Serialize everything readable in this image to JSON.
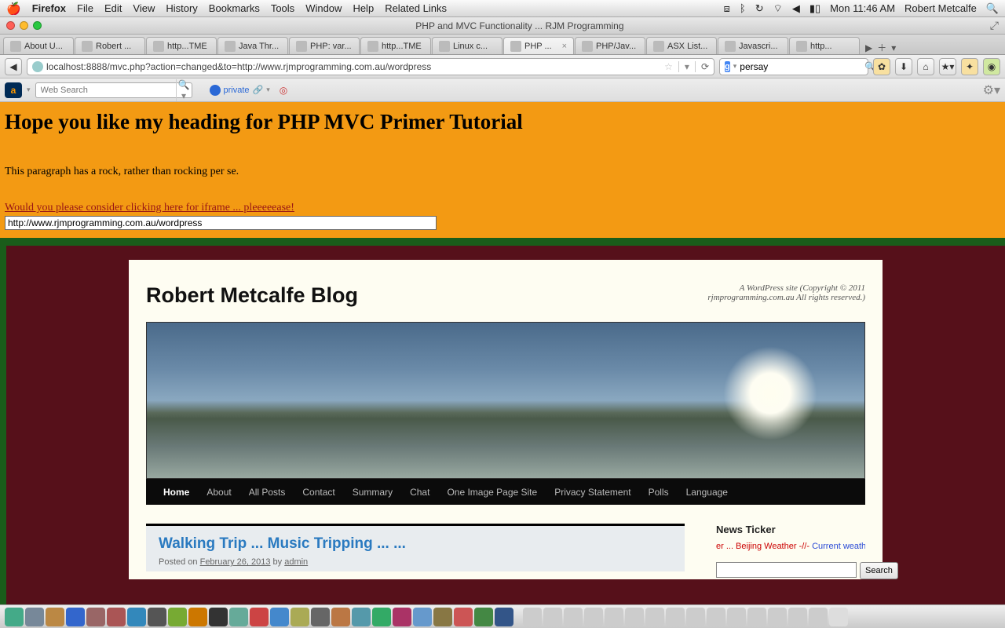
{
  "menubar": {
    "app": "Firefox",
    "items": [
      "File",
      "Edit",
      "View",
      "History",
      "Bookmarks",
      "Tools",
      "Window",
      "Help",
      "Related Links"
    ],
    "clock": "Mon 11:46 AM",
    "user": "Robert Metcalfe"
  },
  "window": {
    "title": "PHP and MVC Functionality ... RJM Programming"
  },
  "tabs": [
    {
      "label": "About U..."
    },
    {
      "label": "Robert ..."
    },
    {
      "label": "http...TME"
    },
    {
      "label": "Java Thr..."
    },
    {
      "label": "PHP: var..."
    },
    {
      "label": "http...TME"
    },
    {
      "label": "Linux c..."
    },
    {
      "label": "PHP ...",
      "active": true,
      "closeable": true
    },
    {
      "label": "PHP/Jav..."
    },
    {
      "label": "ASX List..."
    },
    {
      "label": "Javascri..."
    },
    {
      "label": "http..."
    }
  ],
  "url": {
    "value": "localhost:8888/mvc.php?action=changed&to=http://www.rjmprogramming.com.au/wordpress"
  },
  "search": {
    "value": "persay"
  },
  "toolbar2": {
    "websearch_placeholder": "Web Search",
    "private": "private"
  },
  "page": {
    "heading": "Hope you like my heading for PHP MVC Primer Tutorial",
    "paragraph": "This paragraph has a rock, rather than rocking per se.",
    "link": "Would you please consider clicking here for iframe ... pleeeeease!",
    "textbox": "http://www.rjmprogramming.com.au/wordpress"
  },
  "blog": {
    "title": "Robert Metcalfe Blog",
    "tagline": "A WordPress site (Copyright © 2011 rjmprogramming.com.au All rights reserved.)",
    "nav": [
      "Home",
      "About",
      "All Posts",
      "Contact",
      "Summary",
      "Chat",
      "One Image Page Site",
      "Privacy Statement",
      "Polls",
      "Language"
    ],
    "post_title": "Walking Trip ... Music Tripping ... ...",
    "post_meta_prefix": "Posted on ",
    "post_date": "February 26, 2013",
    "post_by": " by ",
    "post_author": "admin",
    "sidebar_title": "News Ticker",
    "ticker_a": "er ... Beijing Weather -//- ",
    "ticker_b": "Current weather: Su",
    "search_btn": "Search"
  }
}
